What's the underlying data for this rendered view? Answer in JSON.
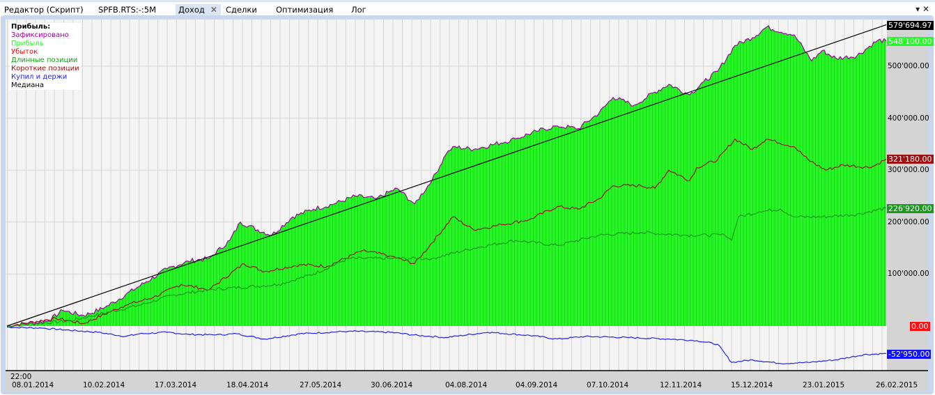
{
  "tabs": [
    {
      "label": "Редактор (Скрипт)"
    },
    {
      "label": "SPFB.RTS:-:5M"
    },
    {
      "label": "Доход",
      "active": true
    },
    {
      "label": "Сделки"
    },
    {
      "label": "Оптимизация"
    },
    {
      "label": "Лог"
    }
  ],
  "toolbar": {
    "menu_icon": "▾",
    "close_icon": "✕",
    "tab_close_icon": "✕"
  },
  "legend": {
    "title": "Прибыль:",
    "items": [
      {
        "label": "Зафиксировано",
        "color": "#a000a0"
      },
      {
        "label": "Прибыль",
        "color": "#22ff22"
      },
      {
        "label": "Убыток",
        "color": "#ff0000"
      },
      {
        "label": "Длинные позиции",
        "color": "#1a9a1a"
      },
      {
        "label": "Короткие позиции",
        "color": "#a01010"
      },
      {
        "label": "Купил и держи",
        "color": "#2020ff"
      },
      {
        "label": "Медиана",
        "color": "#000000"
      }
    ]
  },
  "chart_data": {
    "type": "area",
    "title": "Доход",
    "time_label": "22:00",
    "xlim": [
      0,
      252.4
    ],
    "ylim": [
      -85000,
      595000
    ],
    "y_ticks": [
      {
        "v": 100000,
        "label": "100'000.00"
      },
      {
        "v": 200000,
        "label": "200'000.00"
      },
      {
        "v": 300000,
        "label": "300'000.00"
      },
      {
        "v": 400000,
        "label": "400'000.00"
      },
      {
        "v": 500000,
        "label": "500'000.00"
      }
    ],
    "x_ticks": [
      {
        "x": 1,
        "label": "08.01.2014"
      },
      {
        "x": 21.4,
        "label": "10.02.2014"
      },
      {
        "x": 42,
        "label": "17.03.2014"
      },
      {
        "x": 62.6,
        "label": "18.04.2014"
      },
      {
        "x": 83.6,
        "label": "27.05.2014"
      },
      {
        "x": 104,
        "label": "30.06.2014"
      },
      {
        "x": 125.4,
        "label": "04.08.2014"
      },
      {
        "x": 145.6,
        "label": "04.09.2014"
      },
      {
        "x": 166,
        "label": "07.10.2014"
      },
      {
        "x": 187,
        "label": "12.11.2014"
      },
      {
        "x": 207.4,
        "label": "15.12.2014"
      },
      {
        "x": 228,
        "label": "23.01.2015"
      },
      {
        "x": 249,
        "label": "26.02.2015"
      }
    ],
    "last_values": [
      {
        "label": "579'694.97",
        "v": 579694.97,
        "bg": "#000000"
      },
      {
        "label": "548'100.00",
        "v": 548100,
        "bg": "#22ff22"
      },
      {
        "label": "321'180.00",
        "v": 321180,
        "bg": "#a01010"
      },
      {
        "label": "226'920.00",
        "v": 226920,
        "bg": "#1a9a1a"
      },
      {
        "label": "0.00",
        "v": 0,
        "bg": "#ff1010"
      },
      {
        "label": "-52'950.00",
        "v": -52950,
        "bg": "#1010ff"
      }
    ],
    "series": [
      {
        "name": "Зафиксировано / Прибыль",
        "color": "#a000a0",
        "fill": "#22ff22",
        "points": [
          [
            0,
            0
          ],
          [
            6,
            5000
          ],
          [
            12,
            10000
          ],
          [
            16,
            30000
          ],
          [
            22,
            20000
          ],
          [
            28,
            35000
          ],
          [
            34,
            60000
          ],
          [
            40,
            85000
          ],
          [
            46,
            110000
          ],
          [
            52,
            125000
          ],
          [
            58,
            130000
          ],
          [
            64,
            165000
          ],
          [
            67,
            200000
          ],
          [
            72,
            185000
          ],
          [
            76,
            175000
          ],
          [
            82,
            210000
          ],
          [
            88,
            225000
          ],
          [
            94,
            235000
          ],
          [
            100,
            250000
          ],
          [
            106,
            245000
          ],
          [
            112,
            265000
          ],
          [
            117,
            235000
          ],
          [
            122,
            280000
          ],
          [
            126,
            330000
          ],
          [
            128,
            345000
          ],
          [
            134,
            340000
          ],
          [
            140,
            350000
          ],
          [
            146,
            360000
          ],
          [
            152,
            375000
          ],
          [
            158,
            385000
          ],
          [
            164,
            380000
          ],
          [
            170,
            410000
          ],
          [
            174,
            440000
          ],
          [
            180,
            425000
          ],
          [
            186,
            450000
          ],
          [
            190,
            465000
          ],
          [
            196,
            445000
          ],
          [
            200,
            470000
          ],
          [
            204,
            490000
          ],
          [
            209,
            540000
          ],
          [
            214,
            555000
          ],
          [
            218,
            575000
          ],
          [
            226,
            560000
          ],
          [
            231,
            510000
          ],
          [
            234,
            530000
          ],
          [
            238,
            515000
          ],
          [
            244,
            520000
          ],
          [
            250,
            550000
          ],
          [
            252.4,
            548100
          ]
        ]
      },
      {
        "name": "Короткие позиции",
        "color": "#a01010",
        "points": [
          [
            0,
            0
          ],
          [
            14,
            15000
          ],
          [
            22,
            5000
          ],
          [
            34,
            40000
          ],
          [
            42,
            55000
          ],
          [
            50,
            80000
          ],
          [
            58,
            70000
          ],
          [
            68,
            120000
          ],
          [
            74,
            105000
          ],
          [
            84,
            118000
          ],
          [
            92,
            115000
          ],
          [
            102,
            145000
          ],
          [
            110,
            135000
          ],
          [
            117,
            120000
          ],
          [
            122,
            160000
          ],
          [
            128,
            210000
          ],
          [
            134,
            185000
          ],
          [
            142,
            195000
          ],
          [
            150,
            205000
          ],
          [
            158,
            230000
          ],
          [
            164,
            225000
          ],
          [
            170,
            245000
          ],
          [
            174,
            270000
          ],
          [
            182,
            270000
          ],
          [
            186,
            265000
          ],
          [
            190,
            300000
          ],
          [
            196,
            280000
          ],
          [
            198,
            305000
          ],
          [
            204,
            320000
          ],
          [
            209,
            360000
          ],
          [
            214,
            340000
          ],
          [
            218,
            360000
          ],
          [
            226,
            345000
          ],
          [
            230,
            320000
          ],
          [
            235,
            300000
          ],
          [
            240,
            310000
          ],
          [
            248,
            305000
          ],
          [
            252.4,
            321180
          ]
        ]
      },
      {
        "name": "Длинные позиции",
        "color": "#1a9a1a",
        "points": [
          [
            0,
            0
          ],
          [
            18,
            10000
          ],
          [
            38,
            40000
          ],
          [
            48,
            60000
          ],
          [
            58,
            70000
          ],
          [
            78,
            80000
          ],
          [
            88,
            100000
          ],
          [
            98,
            130000
          ],
          [
            110,
            130000
          ],
          [
            122,
            130000
          ],
          [
            134,
            150000
          ],
          [
            146,
            165000
          ],
          [
            158,
            155000
          ],
          [
            170,
            175000
          ],
          [
            182,
            180000
          ],
          [
            194,
            175000
          ],
          [
            206,
            175000
          ],
          [
            208,
            165000
          ],
          [
            210,
            210000
          ],
          [
            216,
            220000
          ],
          [
            222,
            225000
          ],
          [
            226,
            210000
          ],
          [
            234,
            210000
          ],
          [
            244,
            215000
          ],
          [
            252.4,
            226920
          ]
        ]
      },
      {
        "name": "Купил и держи",
        "color": "#2020ff",
        "points": [
          [
            0,
            -2000
          ],
          [
            10,
            -4000
          ],
          [
            26,
            -12000
          ],
          [
            34,
            -20000
          ],
          [
            38,
            -15000
          ],
          [
            46,
            -12000
          ],
          [
            52,
            -16000
          ],
          [
            60,
            -17000
          ],
          [
            66,
            -15000
          ],
          [
            74,
            -25000
          ],
          [
            84,
            -15000
          ],
          [
            98,
            -10000
          ],
          [
            110,
            -12000
          ],
          [
            118,
            -18000
          ],
          [
            126,
            -22000
          ],
          [
            138,
            -12000
          ],
          [
            150,
            -18000
          ],
          [
            158,
            -25000
          ],
          [
            166,
            -20000
          ],
          [
            178,
            -22000
          ],
          [
            190,
            -25000
          ],
          [
            198,
            -28000
          ],
          [
            204,
            -35000
          ],
          [
            208,
            -70000
          ],
          [
            214,
            -65000
          ],
          [
            222,
            -72000
          ],
          [
            230,
            -70000
          ],
          [
            238,
            -65000
          ],
          [
            246,
            -55000
          ],
          [
            252.4,
            -52950
          ]
        ]
      },
      {
        "name": "Медиана",
        "color": "#000000",
        "points": [
          [
            0,
            0
          ],
          [
            252.4,
            579694.97
          ]
        ]
      }
    ]
  }
}
